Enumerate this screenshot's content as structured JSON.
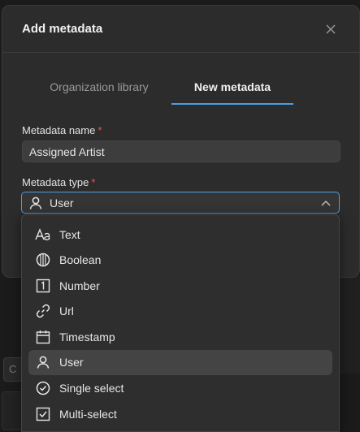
{
  "modal": {
    "title": "Add metadata",
    "close_icon": "close-icon"
  },
  "tabs": [
    {
      "label": "Organization library",
      "active": false
    },
    {
      "label": "New metadata",
      "active": true
    }
  ],
  "form": {
    "name_label": "Metadata name",
    "name_value": "Assigned Artist",
    "type_label": "Metadata type",
    "required_mark": "*",
    "type_value": "User"
  },
  "dropdown": {
    "options": [
      {
        "label": "Text",
        "icon": "text-icon"
      },
      {
        "label": "Boolean",
        "icon": "boolean-icon"
      },
      {
        "label": "Number",
        "icon": "number-icon"
      },
      {
        "label": "Url",
        "icon": "link-icon"
      },
      {
        "label": "Timestamp",
        "icon": "calendar-icon"
      },
      {
        "label": "User",
        "icon": "user-icon",
        "selected": true
      },
      {
        "label": "Single select",
        "icon": "single-select-icon"
      },
      {
        "label": "Multi-select",
        "icon": "multi-select-icon"
      }
    ]
  },
  "background": {
    "card_letter": "C"
  },
  "colors": {
    "accent": "#4a9fe8",
    "required": "#e8584f",
    "modal_bg": "#2c2c2c"
  }
}
